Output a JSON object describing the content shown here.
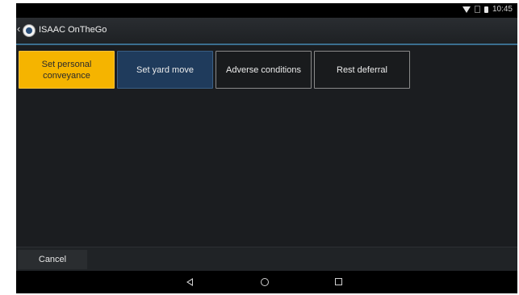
{
  "status_bar": {
    "time": "10:45"
  },
  "app_bar": {
    "title": "ISAAC OnTheGo"
  },
  "options": [
    {
      "label": "Set personal conveyance",
      "state": "selected"
    },
    {
      "label": "Set yard move",
      "state": "focused"
    },
    {
      "label": "Adverse conditions",
      "state": "normal"
    },
    {
      "label": "Rest deferral",
      "state": "normal"
    }
  ],
  "footer": {
    "cancel_label": "Cancel"
  },
  "colors": {
    "selected": "#f5b400",
    "focused": "#1f3b5c",
    "accent": "#3b6f8f"
  },
  "icons": {
    "status": [
      "wifi-icon",
      "sim-icon",
      "battery-icon"
    ],
    "nav": [
      "nav-back-icon",
      "nav-home-icon",
      "nav-recents-icon"
    ]
  }
}
